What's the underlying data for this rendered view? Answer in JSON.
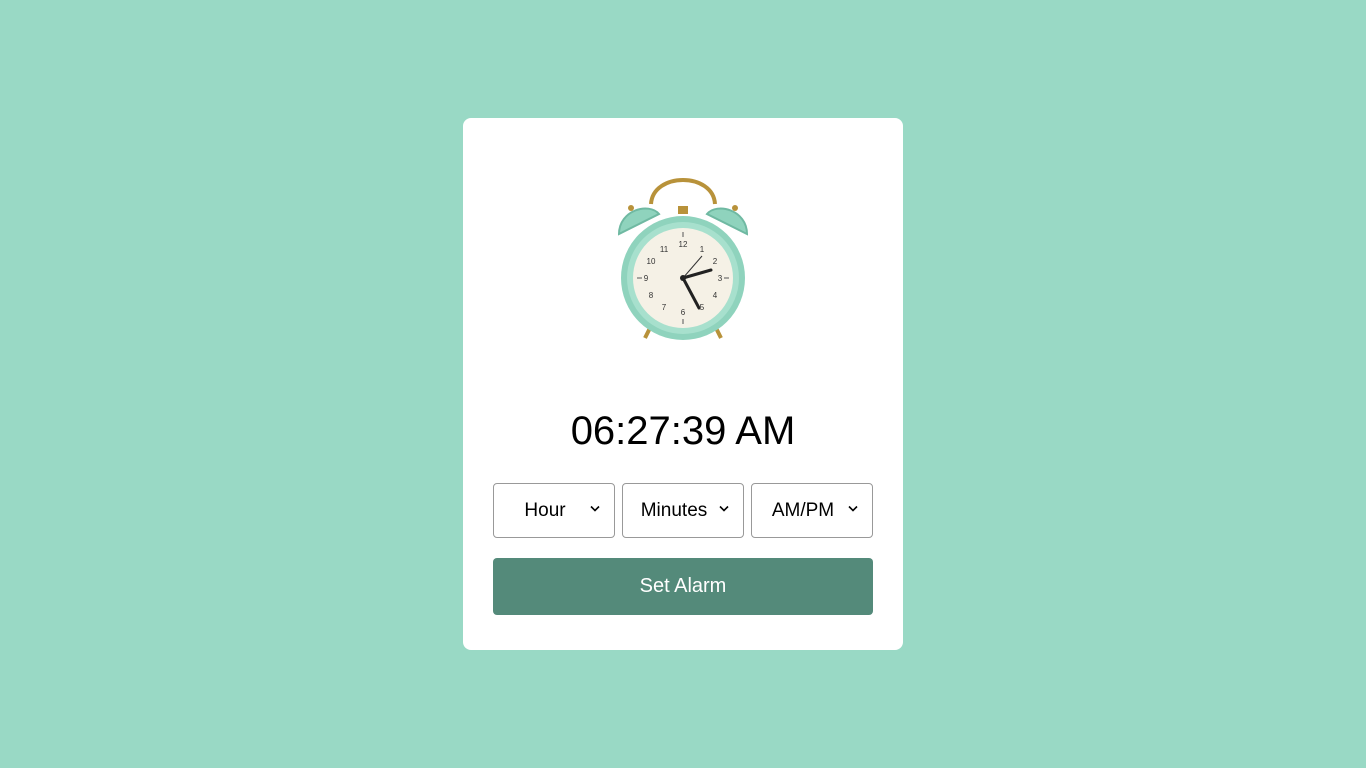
{
  "clock": {
    "image": "alarm-clock-icon",
    "current_time": "06:27:39 AM"
  },
  "selects": {
    "hour": {
      "value": "Hour"
    },
    "minutes": {
      "value": "Minutes"
    },
    "ampm": {
      "value": "AM/PM"
    }
  },
  "actions": {
    "set_alarm_label": "Set Alarm"
  },
  "colors": {
    "background": "#99d9c5",
    "card": "#ffffff",
    "button": "#548a7a",
    "clock_body": "#8fd3bd",
    "clock_bell_frame": "#b8923a"
  }
}
